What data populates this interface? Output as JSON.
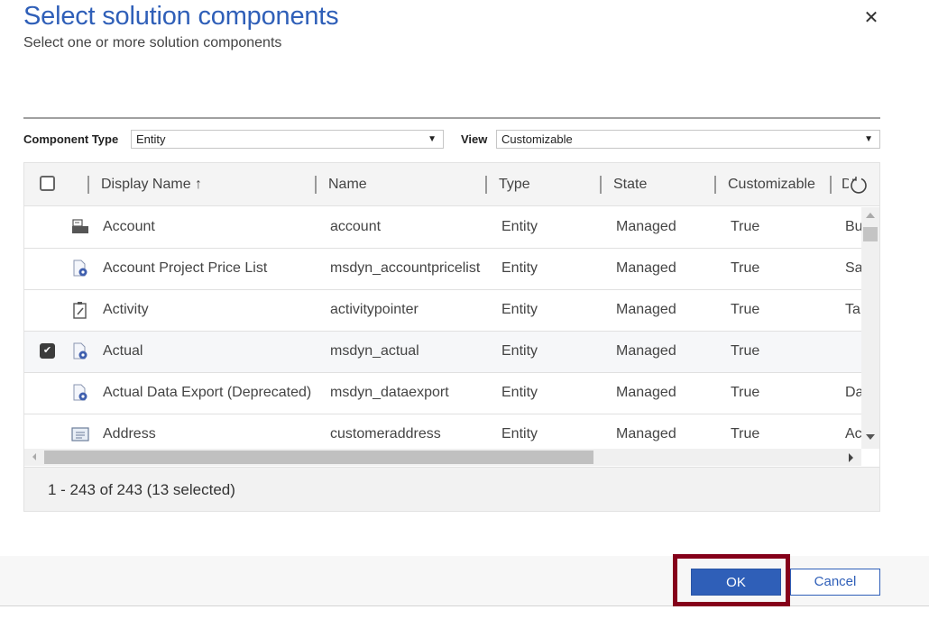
{
  "dialog": {
    "title": "Select solution components",
    "subtitle": "Select one or more solution components",
    "close_icon": "close-icon"
  },
  "filters": {
    "component_type_label": "Component Type",
    "component_type_value": "Entity",
    "view_label": "View",
    "view_value": "Customizable"
  },
  "grid": {
    "columns": [
      "Display Name ↑",
      "Name",
      "Type",
      "State",
      "Customizable",
      "D"
    ],
    "sort": {
      "column": "Display Name",
      "direction": "ascending"
    },
    "rows": [
      {
        "icon": "entity-folder-icon",
        "display_name": "Account",
        "name": "account",
        "type": "Entity",
        "state": "Managed",
        "customizable": "True",
        "description": "Bu",
        "selected": false
      },
      {
        "icon": "entity-gear-icon",
        "display_name": "Account Project Price List",
        "name": "msdyn_accountpricelist",
        "type": "Entity",
        "state": "Managed",
        "customizable": "True",
        "description": "Sa",
        "selected": false
      },
      {
        "icon": "clipboard-icon",
        "display_name": "Activity",
        "name": "activitypointer",
        "type": "Entity",
        "state": "Managed",
        "customizable": "True",
        "description": "Ta",
        "selected": false
      },
      {
        "icon": "entity-gear-icon",
        "display_name": "Actual",
        "name": "msdyn_actual",
        "type": "Entity",
        "state": "Managed",
        "customizable": "True",
        "description": "",
        "selected": true
      },
      {
        "icon": "entity-gear-icon",
        "display_name": "Actual Data Export (Deprecated)",
        "name": "msdyn_dataexport",
        "type": "Entity",
        "state": "Managed",
        "customizable": "True",
        "description": "Da",
        "selected": false
      },
      {
        "icon": "address-card-icon",
        "display_name": "Address",
        "name": "customeraddress",
        "type": "Entity",
        "state": "Managed",
        "customizable": "True",
        "description": "Ac",
        "selected": false
      }
    ],
    "footer_status": "1 - 243 of 243 (13 selected)"
  },
  "buttons": {
    "ok_label": "OK",
    "cancel_label": "Cancel"
  },
  "colors": {
    "accent": "#2f5fb8",
    "highlight_border": "#85001a"
  }
}
